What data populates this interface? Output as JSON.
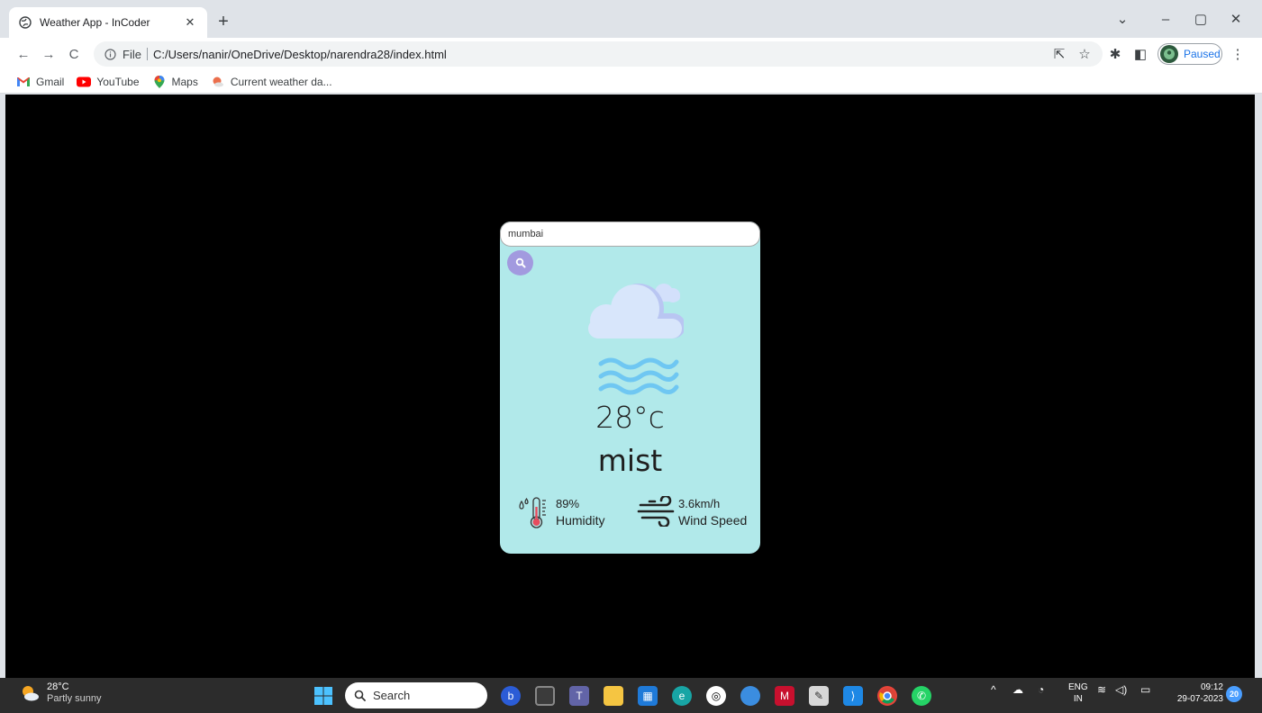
{
  "browser": {
    "tab_title": "Weather App - InCoder",
    "url_scheme": "File",
    "url": "C:/Users/nanir/OneDrive/Desktop/narendra28/index.html",
    "profile_status": "Paused",
    "bookmarks": [
      "Gmail",
      "YouTube",
      "Maps",
      "Current weather da..."
    ]
  },
  "weather_card": {
    "search_value": "mumbai",
    "temperature": "28°c",
    "condition": "mist",
    "humidity_value": "89%",
    "humidity_label": "Humidity",
    "wind_value": "3.6km/h",
    "wind_label": "Wind Speed",
    "colors": {
      "card_bg": "#b1e9ea",
      "search_button": "#a29adf",
      "cloud": "#d8e6fb",
      "mist": "#6fc7f2"
    }
  },
  "taskbar": {
    "weather_temp": "28°C",
    "weather_desc": "Partly sunny",
    "search_label": "Search",
    "lang_top": "ENG",
    "lang_bottom": "IN",
    "time": "09:12",
    "date": "29-07-2023",
    "notification_count": "20"
  }
}
